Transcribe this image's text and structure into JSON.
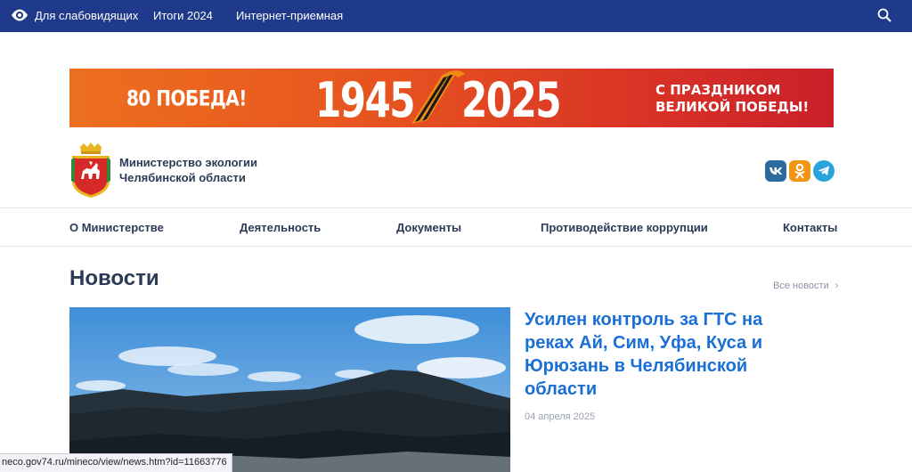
{
  "topbar": {
    "accessibility_label": "Для слабовидящих",
    "link_results": "Итоги 2024",
    "link_reception": "Интернет-приемная"
  },
  "banner": {
    "left_text": "80 ПОБЕДА!",
    "year_start": "1945",
    "year_end": "2025",
    "right_line1": "С ПРАЗДНИКОМ",
    "right_line2": "ВЕЛИКОЙ ПОБЕДЫ!"
  },
  "org": {
    "line1": "Министерство экологии",
    "line2": "Челябинской области"
  },
  "nav": {
    "items": [
      {
        "label": "О Министерстве"
      },
      {
        "label": "Деятельность"
      },
      {
        "label": "Документы"
      },
      {
        "label": "Противодействие коррупции"
      },
      {
        "label": "Контакты"
      }
    ]
  },
  "news": {
    "title": "Новости",
    "all_label": "Все новости",
    "featured": {
      "headline": "Усилен контроль за ГТС на реках Ай, Сим, Уфа, Куса и Юрюзань в Челябинской области",
      "date": "04 апреля 2025"
    }
  },
  "status_bar": {
    "url": "neco.gov74.ru/mineco/view/news.htm?id=11663776"
  },
  "colors": {
    "topbar": "#1f3a8a",
    "accent_link": "#1a6fd6",
    "text": "#2b3a57"
  }
}
